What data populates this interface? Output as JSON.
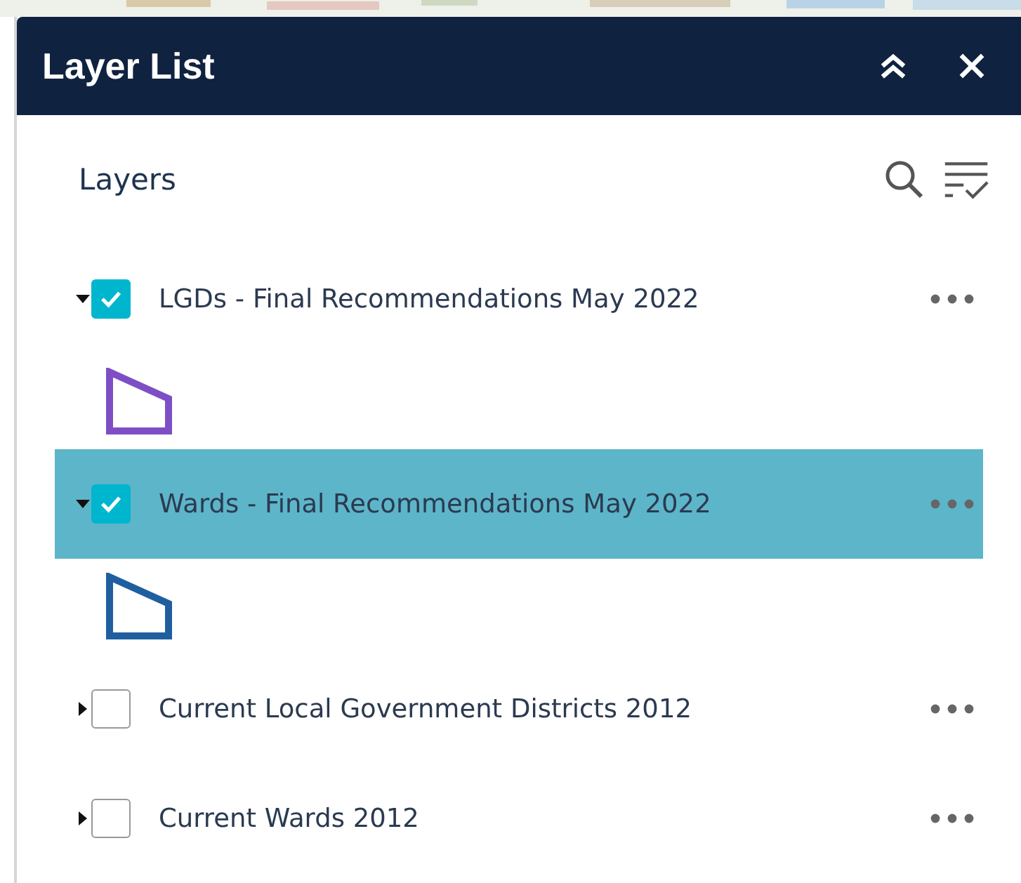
{
  "panel": {
    "title": "Layer List",
    "section_title": "Layers"
  },
  "layers": [
    {
      "name": "LGDs - Final Recommendations May 2022",
      "expanded": true,
      "checked": true,
      "selected": false,
      "legend": {
        "color": "#7e4fc4"
      }
    },
    {
      "name": "Wards - Final Recommendations May 2022",
      "expanded": true,
      "checked": true,
      "selected": true,
      "legend": {
        "color": "#1f5fa0"
      }
    },
    {
      "name": "Current Local Government Districts 2012",
      "expanded": false,
      "checked": false,
      "selected": false
    },
    {
      "name": "Current Wards 2012",
      "expanded": false,
      "checked": false,
      "selected": false
    }
  ]
}
